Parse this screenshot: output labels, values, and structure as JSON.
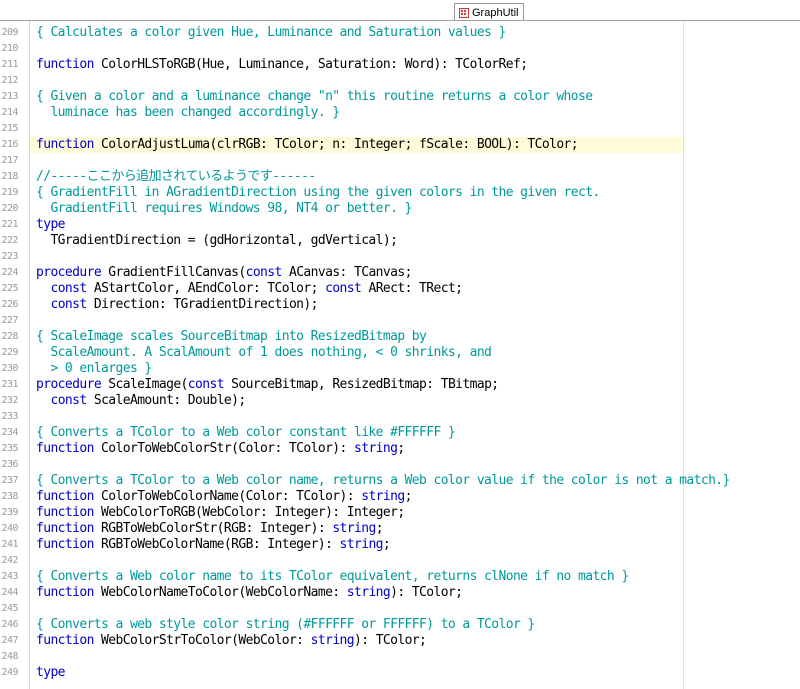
{
  "tab": {
    "title": "GraphUtil"
  },
  "editor": {
    "lines": [
      {
        "n": "209",
        "t": [
          [
            "cm",
            "{ Calculates a color given Hue, Luminance and Saturation values }"
          ]
        ]
      },
      {
        "n": "210",
        "t": []
      },
      {
        "n": "211",
        "t": [
          [
            "kw",
            "function"
          ],
          [
            "tx",
            " ColorHLSToRGB(Hue, Luminance, Saturation: Word): TColorRef;"
          ]
        ]
      },
      {
        "n": "212",
        "t": []
      },
      {
        "n": "213",
        "t": [
          [
            "cm",
            "{ Given a color and a luminance change \"n\" this routine returns a color whose"
          ]
        ]
      },
      {
        "n": "214",
        "t": [
          [
            "cm",
            "  luminace has been changed accordingly. }"
          ]
        ]
      },
      {
        "n": "215",
        "t": []
      },
      {
        "n": "216",
        "hl": true,
        "t": [
          [
            "kw",
            "function"
          ],
          [
            "tx",
            " ColorAdjustLuma(clrRGB: TColor; n: Integer; fScale: BOOL): TColor;"
          ]
        ]
      },
      {
        "n": "217",
        "t": []
      },
      {
        "n": "218",
        "t": [
          [
            "cm",
            "//-----ここから追加されているようです------"
          ]
        ]
      },
      {
        "n": "219",
        "t": [
          [
            "cm",
            "{ GradientFill in AGradientDirection using the given colors in the given rect."
          ]
        ]
      },
      {
        "n": "220",
        "t": [
          [
            "cm",
            "  GradientFill requires Windows 98, NT4 or better. }"
          ]
        ]
      },
      {
        "n": "221",
        "t": [
          [
            "kw",
            "type"
          ]
        ]
      },
      {
        "n": "222",
        "t": [
          [
            "tx",
            "  TGradientDirection = (gdHorizontal, gdVertical);"
          ]
        ]
      },
      {
        "n": "223",
        "t": []
      },
      {
        "n": "224",
        "t": [
          [
            "kw",
            "procedure"
          ],
          [
            "tx",
            " GradientFillCanvas("
          ],
          [
            "kw",
            "const"
          ],
          [
            "tx",
            " ACanvas: TCanvas;"
          ]
        ]
      },
      {
        "n": "225",
        "t": [
          [
            "tx",
            "  "
          ],
          [
            "kw",
            "const"
          ],
          [
            "tx",
            " AStartColor, AEndColor: TColor; "
          ],
          [
            "kw",
            "const"
          ],
          [
            "tx",
            " ARect: TRect;"
          ]
        ]
      },
      {
        "n": "226",
        "t": [
          [
            "tx",
            "  "
          ],
          [
            "kw",
            "const"
          ],
          [
            "tx",
            " Direction: TGradientDirection);"
          ]
        ]
      },
      {
        "n": "227",
        "t": []
      },
      {
        "n": "228",
        "t": [
          [
            "cm",
            "{ ScaleImage scales SourceBitmap into ResizedBitmap by"
          ]
        ]
      },
      {
        "n": "229",
        "t": [
          [
            "cm",
            "  ScaleAmount. A ScalAmount of 1 does nothing, < 0 shrinks, and"
          ]
        ]
      },
      {
        "n": "230",
        "t": [
          [
            "cm",
            "  > 0 enlarges }"
          ]
        ]
      },
      {
        "n": "231",
        "t": [
          [
            "kw",
            "procedure"
          ],
          [
            "tx",
            " ScaleImage("
          ],
          [
            "kw",
            "const"
          ],
          [
            "tx",
            " SourceBitmap, ResizedBitmap: TBitmap;"
          ]
        ]
      },
      {
        "n": "232",
        "t": [
          [
            "tx",
            "  "
          ],
          [
            "kw",
            "const"
          ],
          [
            "tx",
            " ScaleAmount: Double);"
          ]
        ]
      },
      {
        "n": "233",
        "t": []
      },
      {
        "n": "234",
        "t": [
          [
            "cm",
            "{ Converts a TColor to a Web color constant like #FFFFFF }"
          ]
        ]
      },
      {
        "n": "235",
        "t": [
          [
            "kw",
            "function"
          ],
          [
            "tx",
            " ColorToWebColorStr(Color: TColor): "
          ],
          [
            "kw",
            "string"
          ],
          [
            "tx",
            ";"
          ]
        ]
      },
      {
        "n": "236",
        "t": []
      },
      {
        "n": "237",
        "t": [
          [
            "cm",
            "{ Converts a TColor to a Web color name, returns a Web color value if the color is not a match.}"
          ]
        ]
      },
      {
        "n": "238",
        "t": [
          [
            "kw",
            "function"
          ],
          [
            "tx",
            " ColorToWebColorName(Color: TColor): "
          ],
          [
            "kw",
            "string"
          ],
          [
            "tx",
            ";"
          ]
        ]
      },
      {
        "n": "239",
        "t": [
          [
            "kw",
            "function"
          ],
          [
            "tx",
            " WebColorToRGB(WebColor: Integer): Integer;"
          ]
        ]
      },
      {
        "n": "240",
        "t": [
          [
            "kw",
            "function"
          ],
          [
            "tx",
            " RGBToWebColorStr(RGB: Integer): "
          ],
          [
            "kw",
            "string"
          ],
          [
            "tx",
            ";"
          ]
        ]
      },
      {
        "n": "241",
        "t": [
          [
            "kw",
            "function"
          ],
          [
            "tx",
            " RGBToWebColorName(RGB: Integer): "
          ],
          [
            "kw",
            "string"
          ],
          [
            "tx",
            ";"
          ]
        ]
      },
      {
        "n": "242",
        "t": []
      },
      {
        "n": "243",
        "t": [
          [
            "cm",
            "{ Converts a Web color name to its TColor equivalent, returns clNone if no match }"
          ]
        ]
      },
      {
        "n": "244",
        "t": [
          [
            "kw",
            "function"
          ],
          [
            "tx",
            " WebColorNameToColor(WebColorName: "
          ],
          [
            "kw",
            "string"
          ],
          [
            "tx",
            "): TColor;"
          ]
        ]
      },
      {
        "n": "245",
        "t": []
      },
      {
        "n": "246",
        "t": [
          [
            "cm",
            "{ Converts a web style color string (#FFFFFF or FFFFFF) to a TColor }"
          ]
        ]
      },
      {
        "n": "247",
        "t": [
          [
            "kw",
            "function"
          ],
          [
            "tx",
            " WebColorStrToColor(WebColor: "
          ],
          [
            "kw",
            "string"
          ],
          [
            "tx",
            "): TColor;"
          ]
        ]
      },
      {
        "n": "248",
        "t": []
      },
      {
        "n": "249",
        "t": [
          [
            "kw",
            "type"
          ]
        ]
      }
    ]
  },
  "colors": {
    "keyword": "#0000cc",
    "comment": "#009999",
    "text": "#000000",
    "line_number": "#999999",
    "current_line": "#fffbd9"
  }
}
